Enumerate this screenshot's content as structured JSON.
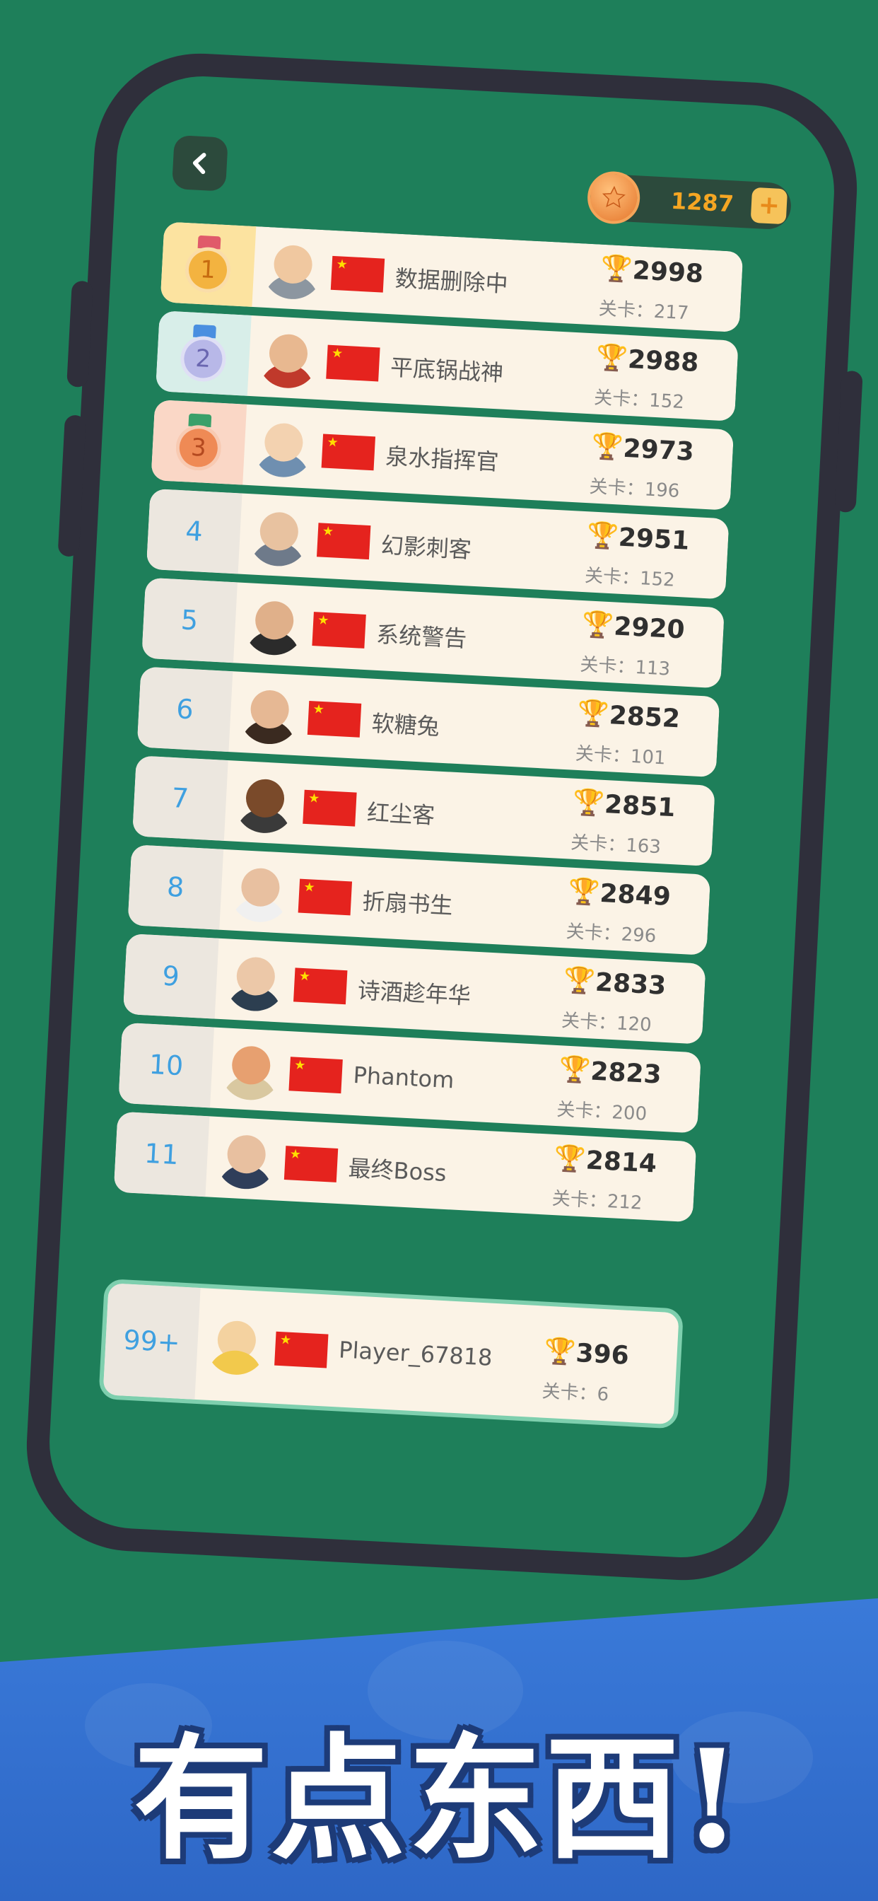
{
  "header": {
    "back_icon": "chevron-left-icon",
    "coins": "1287",
    "coin_icon": "star-coin-icon",
    "add_label": "+"
  },
  "colors": {
    "background": "#1e7f5a",
    "accent": "#f5a623",
    "rank_text": "#3fa0e0"
  },
  "leaderboard": {
    "level_prefix": "关卡：",
    "rows": [
      {
        "rank": "1",
        "medal": "gold",
        "name": "数据删除中",
        "score": "2998",
        "levels": "217",
        "avatar_skin": "#f0c8a0",
        "avatar_outfit": "#8c96a0"
      },
      {
        "rank": "2",
        "medal": "silver",
        "name": "平底锅战神",
        "score": "2988",
        "levels": "152",
        "avatar_skin": "#e8b890",
        "avatar_outfit": "#c0392b"
      },
      {
        "rank": "3",
        "medal": "bronze",
        "name": "泉水指挥官",
        "score": "2973",
        "levels": "196",
        "avatar_skin": "#f3d2b0",
        "avatar_outfit": "#6f8fb0"
      },
      {
        "rank": "4",
        "medal": "",
        "name": "幻影刺客",
        "score": "2951",
        "levels": "152",
        "avatar_skin": "#e8c2a0",
        "avatar_outfit": "#6e7a8a"
      },
      {
        "rank": "5",
        "medal": "",
        "name": "系统警告",
        "score": "2920",
        "levels": "113",
        "avatar_skin": "#e0b08a",
        "avatar_outfit": "#2b2b2b"
      },
      {
        "rank": "6",
        "medal": "",
        "name": "软糖兔",
        "score": "2852",
        "levels": "101",
        "avatar_skin": "#e6b894",
        "avatar_outfit": "#3a2a20"
      },
      {
        "rank": "7",
        "medal": "",
        "name": "红尘客",
        "score": "2851",
        "levels": "163",
        "avatar_skin": "#7a4a2a",
        "avatar_outfit": "#3a3a3a"
      },
      {
        "rank": "8",
        "medal": "",
        "name": "折扇书生",
        "score": "2849",
        "levels": "296",
        "avatar_skin": "#e8c0a0",
        "avatar_outfit": "#f0f0f0"
      },
      {
        "rank": "9",
        "medal": "",
        "name": "诗酒趁年华",
        "score": "2833",
        "levels": "120",
        "avatar_skin": "#ecc8a8",
        "avatar_outfit": "#2c3e50"
      },
      {
        "rank": "10",
        "medal": "",
        "name": "Phantom",
        "score": "2823",
        "levels": "200",
        "avatar_skin": "#e7a070",
        "avatar_outfit": "#d9c8a0"
      },
      {
        "rank": "11",
        "medal": "",
        "name": "最终Boss",
        "score": "2814",
        "levels": "212",
        "avatar_skin": "#e8c0a0",
        "avatar_outfit": "#2f3e5a"
      }
    ]
  },
  "me": {
    "rank": "99+",
    "name": "Player_67818",
    "score": "396",
    "levels": "6",
    "avatar_skin": "#f4d2a0",
    "avatar_outfit": "#f2c94c"
  },
  "slogan": "有点东西!"
}
